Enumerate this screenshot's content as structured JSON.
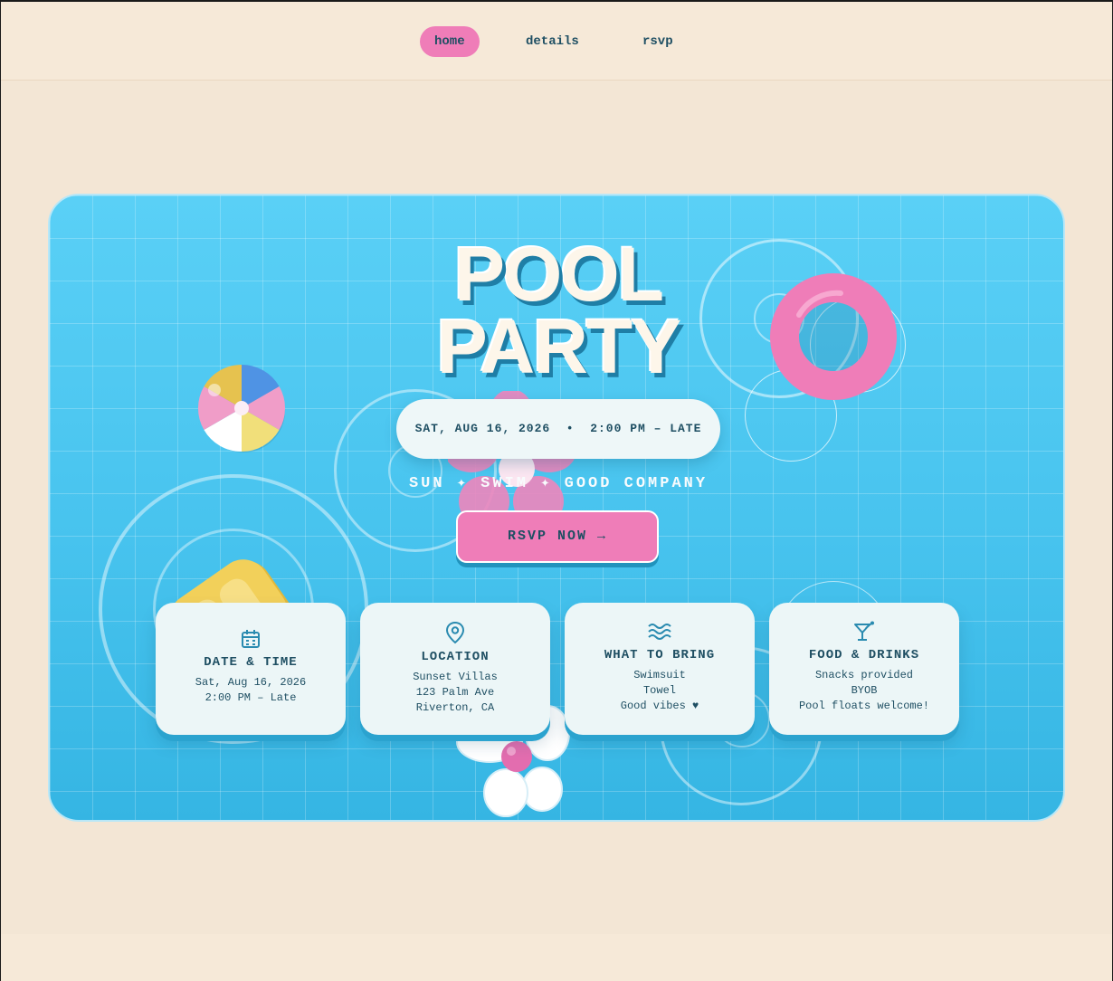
{
  "nav": {
    "items": [
      {
        "label": "home",
        "active": true
      },
      {
        "label": "details",
        "active": false
      },
      {
        "label": "rsvp",
        "active": false
      }
    ]
  },
  "hero": {
    "title_line1": "POOL",
    "title_line2": "PARTY",
    "date_pill": "SAT, AUG 16, 2026  •  2:00 PM – LATE",
    "tagline": "SUN ✦ SWIM ✦ GOOD COMPANY",
    "rsvp_button": "RSVP NOW →"
  },
  "cards": [
    {
      "icon": "calendar-icon",
      "title": "DATE & TIME",
      "lines": [
        "Sat, Aug 16, 2026",
        "2:00 PM – Late"
      ]
    },
    {
      "icon": "location-pin-icon",
      "title": "LOCATION",
      "lines": [
        "Sunset Villas",
        "123 Palm Ave",
        "Riverton, CA"
      ]
    },
    {
      "icon": "waves-icon",
      "title": "WHAT TO BRING",
      "lines": [
        "Swimsuit",
        "Towel",
        "Good vibes ♥"
      ]
    },
    {
      "icon": "cocktail-icon",
      "title": "FOOD & DRINKS",
      "lines": [
        "Snacks provided",
        "BYOB",
        "Pool floats welcome!"
      ]
    }
  ],
  "colors": {
    "accent_pink": "#ef7db8",
    "pool_blue": "#4cc6f0",
    "text_dark": "#1f4f63",
    "background": "#f3e6d5"
  }
}
